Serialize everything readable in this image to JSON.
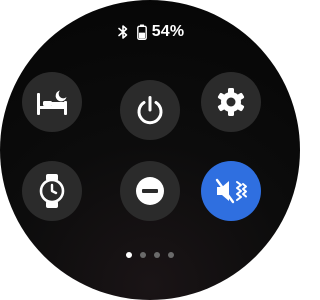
{
  "status": {
    "bluetooth_icon": "bluetooth-icon",
    "battery_icon": "battery-icon",
    "battery_percent": "54%",
    "battery_level": 0.54
  },
  "tiles": [
    {
      "name": "bedtime-mode-button",
      "icon": "bed-moon-icon",
      "active": false
    },
    {
      "name": "power-button",
      "icon": "power-icon",
      "active": false
    },
    {
      "name": "settings-button",
      "icon": "gear-icon",
      "active": false
    },
    {
      "name": "watch-button",
      "icon": "watch-icon",
      "active": false
    },
    {
      "name": "do-not-disturb-button",
      "icon": "minus-circle-icon",
      "active": false
    },
    {
      "name": "sound-mode-button",
      "icon": "mute-vibrate-icon",
      "active": true
    }
  ],
  "pager": {
    "pages": 4,
    "current": 1
  },
  "colors": {
    "tile": "#2b2b2b",
    "active_tile": "#2f6fe0",
    "icon": "#ffffff"
  }
}
